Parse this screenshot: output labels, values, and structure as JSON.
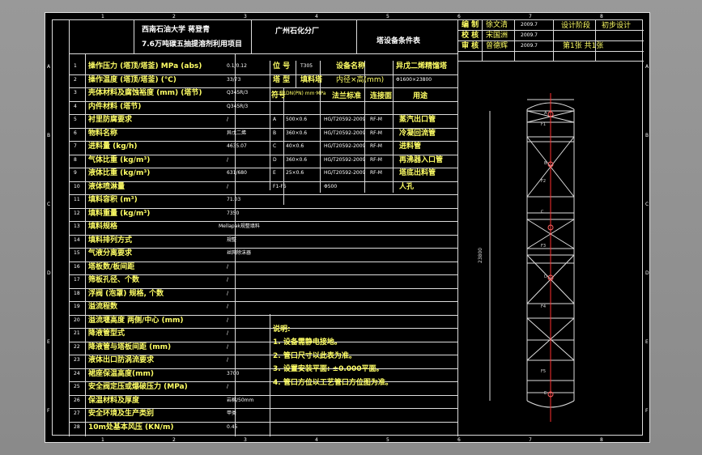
{
  "title": {
    "university": "西南石油大学 蒋登青",
    "project": "7.6万吨碳五抽提溶剂利用项目",
    "company": "广州石化分厂",
    "doc_title": "塔设备条件表",
    "designer_label": "编  制",
    "designer": "徐文清",
    "designer_date": "2009.7",
    "checker_label": "校  核",
    "checker": "宋国洲",
    "checker_date": "2009.7",
    "approver_label": "审  核",
    "approver": "曾德辉",
    "approver_date": "2009.7",
    "stage_label": "设计阶段",
    "stage_value": "初步设计",
    "sheet_info": "第1张  共1张"
  },
  "meta": {
    "tag_label": "位  号",
    "tag_value": "T305",
    "equip_label": "设备名称",
    "equip_value": "异戊二烯精馏塔",
    "type_label": "塔  型",
    "type_value": "填料塔",
    "diameter_label": "内径×高(mm)",
    "diameter_value": "Φ1600×23800",
    "nozzle_header": [
      "符号",
      "DN(PN)\nmm·MPa",
      "法兰标准",
      "连接面",
      "用途"
    ]
  },
  "rows": [
    {
      "no": "1",
      "label": "操作压力 (塔顶/塔釜) MPa (abs)",
      "value": "0.1/0.12"
    },
    {
      "no": "2",
      "label": "操作温度 (塔顶/塔釜) (℃)",
      "value": "33/73"
    },
    {
      "no": "3",
      "label": "壳体材料及腐蚀裕度 (mm) (塔节)",
      "value": "Q345R/3"
    },
    {
      "no": "4",
      "label": "内件材料 (塔节)",
      "value": "Q345R/3"
    },
    {
      "no": "5",
      "label": "衬里防腐要求",
      "value": "/"
    },
    {
      "no": "6",
      "label": "物料名称",
      "value": "异戊二烯"
    },
    {
      "no": "7",
      "label": "进料量 (kg/h)",
      "value": "4635.07"
    },
    {
      "no": "8",
      "label": "气体比重 (kg/m³)",
      "value": "/"
    },
    {
      "no": "9",
      "label": "液体比重 (kg/m³)",
      "value": "631/680"
    },
    {
      "no": "10",
      "label": "液体喷淋量",
      "value": "/"
    },
    {
      "no": "11",
      "label": "填料容积 (m³)",
      "value": "71.03"
    },
    {
      "no": "12",
      "label": "填料重量 (kg/m³)",
      "value": "7350"
    },
    {
      "no": "13",
      "label": "填料规格",
      "value": "Mellapak规整填料"
    },
    {
      "no": "14",
      "label": "填料排列方式",
      "value": "规整"
    },
    {
      "no": "15",
      "label": "气液分离要求",
      "value": "丝网除沫器"
    },
    {
      "no": "16",
      "label": "塔板数/板间距",
      "value": "/"
    },
    {
      "no": "17",
      "label": "筛板孔径、个数",
      "value": "/"
    },
    {
      "no": "18",
      "label": "浮阀 (泡罩) 规格, 个数",
      "value": "/"
    },
    {
      "no": "19",
      "label": "溢流程数",
      "value": "/"
    },
    {
      "no": "20",
      "label": "溢流堰高度 两侧/中心 (mm)",
      "value": "/"
    },
    {
      "no": "21",
      "label": "降液管型式",
      "value": "/"
    },
    {
      "no": "22",
      "label": "降液管与塔板间距 (mm)",
      "value": "/"
    },
    {
      "no": "23",
      "label": "液体出口防涡流要求",
      "value": "/"
    },
    {
      "no": "24",
      "label": "裙座保温高度(mm)",
      "value": "3700"
    },
    {
      "no": "25",
      "label": "安全阀定压或爆破压力 (MPa)",
      "value": "/"
    },
    {
      "no": "26",
      "label": "保温材料及厚度",
      "value": "岩棉/50mm"
    },
    {
      "no": "27",
      "label": "安全环境及生产类别",
      "value": "甲类"
    },
    {
      "no": "28",
      "label": "10m处基本风压 (KN/m)",
      "value": "0.45"
    }
  ],
  "nozzles": [
    {
      "sym": "A",
      "dn": "500×0.6",
      "std": "HG/T20592-2009",
      "face": "RF-M",
      "use": "蒸汽出口管"
    },
    {
      "sym": "B",
      "dn": "360×0.6",
      "std": "HG/T20592-2009",
      "face": "RF-M",
      "use": "冷凝回流管"
    },
    {
      "sym": "C",
      "dn": "40×0.6",
      "std": "HG/T20592-2009",
      "face": "RF-M",
      "use": "进料管"
    },
    {
      "sym": "D",
      "dn": "360×0.6",
      "std": "HG/T20592-2009",
      "face": "RF-M",
      "use": "再沸器入口管"
    },
    {
      "sym": "E",
      "dn": "25×0.6",
      "std": "HG/T20592-2009",
      "face": "RF-M",
      "use": "塔底出料管"
    },
    {
      "sym": "F1-F5",
      "dn": "",
      "std": "Φ500",
      "face": "",
      "use": "人孔"
    }
  ],
  "notes": {
    "heading": "说明:",
    "items": [
      "1. 设备需静电接地。",
      "2. 管口尺寸以此表为准。",
      "3. 设置安装平面: ±0.000平面。",
      "4. 管口方位以工艺管口方位图为准。"
    ]
  },
  "drawing": {
    "height_dim": "23800",
    "labels": [
      "A",
      "B",
      "C",
      "D",
      "E",
      "F1",
      "F2",
      "F3",
      "F4",
      "F5"
    ]
  },
  "zones": {
    "cols": [
      "1",
      "2",
      "3",
      "4",
      "5",
      "6",
      "7",
      "8"
    ],
    "rows": [
      "A",
      "B",
      "C",
      "D",
      "E",
      "F"
    ]
  }
}
